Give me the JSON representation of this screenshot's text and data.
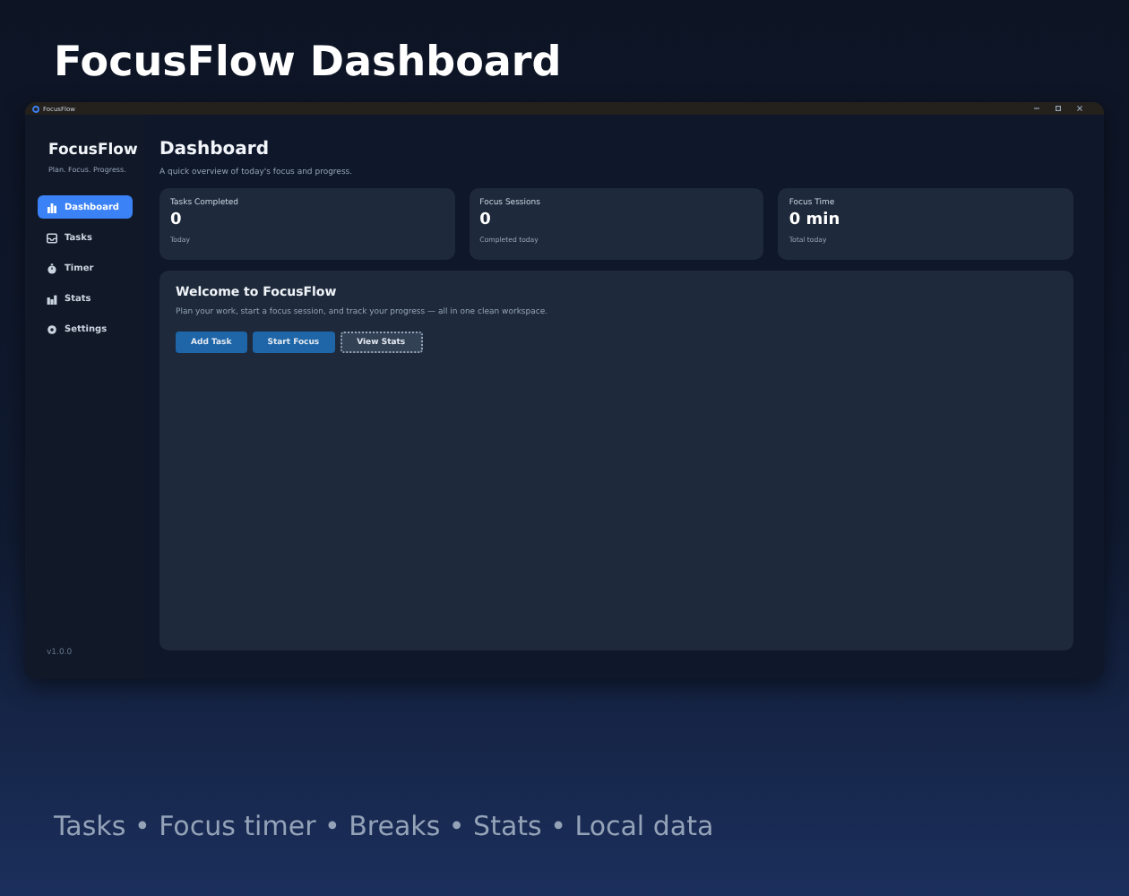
{
  "headline": "FocusFlow Dashboard",
  "window": {
    "title": "FocusFlow"
  },
  "sidebar": {
    "app_name": "FocusFlow",
    "tagline": "Plan. Focus. Progress.",
    "items": [
      {
        "label": "Dashboard",
        "selected": true
      },
      {
        "label": "Tasks",
        "selected": false
      },
      {
        "label": "Timer",
        "selected": false
      },
      {
        "label": "Stats",
        "selected": false
      },
      {
        "label": "Settings",
        "selected": false
      }
    ],
    "version": "v1.0.0"
  },
  "main": {
    "title": "Dashboard",
    "subtitle": "A quick overview of today's focus and progress.",
    "stats": [
      {
        "label": "Tasks Completed",
        "value": "0",
        "note": "Today"
      },
      {
        "label": "Focus Sessions",
        "value": "0",
        "note": "Completed today"
      },
      {
        "label": "Focus Time",
        "value": "0 min",
        "note": "Total today"
      }
    ],
    "welcome": {
      "title": "Welcome to FocusFlow",
      "text": "Plan your work, start a focus session, and track your progress — all in one clean workspace.",
      "buttons": [
        {
          "label": "Add Task",
          "kind": "primary"
        },
        {
          "label": "Start Focus",
          "kind": "primary"
        },
        {
          "label": "View Stats",
          "kind": "secondary"
        }
      ]
    }
  },
  "footer": "Tasks • Focus timer • Breaks • Stats • Local data"
}
